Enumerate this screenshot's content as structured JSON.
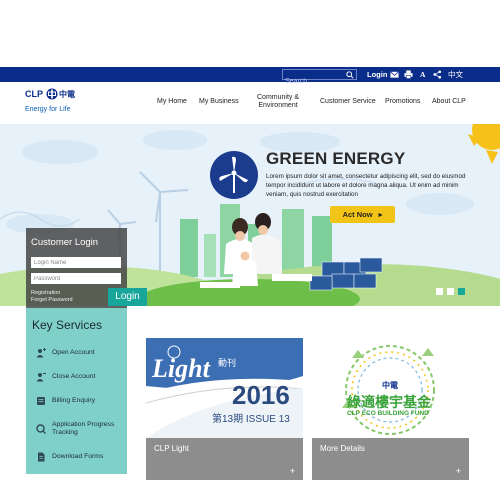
{
  "topbar": {
    "search_placeholder": "Search",
    "login_label": "Login",
    "font_size_label": "A",
    "language_label": "中文",
    "icons": [
      "search-icon",
      "mail-icon",
      "print-icon",
      "share-icon"
    ]
  },
  "logo": {
    "brand": "CLP",
    "brand_cn": "中電",
    "tagline": "Energy for Life"
  },
  "nav": {
    "items": [
      {
        "label": "My Home"
      },
      {
        "label": "My Business"
      },
      {
        "label_line1": "Community &",
        "label_line2": "Environment"
      },
      {
        "label": "Customer Service"
      },
      {
        "label": "Promotions"
      },
      {
        "label": "About CLP"
      }
    ]
  },
  "hero": {
    "title": "GREEN ENERGY",
    "body": "Lorem ipsum dolor sit amet, consectetur adipiscing elit, sed do eiusmod tempor incididunt ut labore et dolore magna aliqua. Ut enim ad minim veniam, quis nostrud exercitation",
    "cta_label": "Act Now",
    "slide_count": 3,
    "active_slide": 3
  },
  "login": {
    "title": "Customer Login",
    "name_placeholder": "Login Name",
    "password_placeholder": "Password",
    "registration_label": "Registration",
    "forget_label": "Forget Password",
    "button_label": "Login"
  },
  "key_services": {
    "title": "Key Services",
    "items": [
      {
        "label": "Open Account",
        "icon": "person-add-icon"
      },
      {
        "label": "Close Account",
        "icon": "person-remove-icon"
      },
      {
        "label": "Billing Enquiry",
        "icon": "billing-icon"
      },
      {
        "label_line1": "Application Progress",
        "label_line2": "Tracking",
        "icon": "search-progress-icon"
      },
      {
        "label": "Download Forms",
        "icon": "document-icon"
      }
    ]
  },
  "cards": [
    {
      "caption": "CLP Light",
      "plus": "+",
      "image": {
        "word": "Light",
        "cn": "動刊",
        "year": "2016",
        "issue": "第13期 ISSUE 13"
      }
    },
    {
      "caption": "More Details",
      "plus": "+",
      "image": {
        "cn_top": "中電",
        "cn_main": "綠適樓宇基金",
        "en": "CLP ECO BUILDING FUND"
      }
    }
  ],
  "colors": {
    "topbar": "#0b2d8a",
    "accent_teal": "#18a59a",
    "key_services_bg": "#7fd0c9",
    "cta": "#f3c418"
  }
}
